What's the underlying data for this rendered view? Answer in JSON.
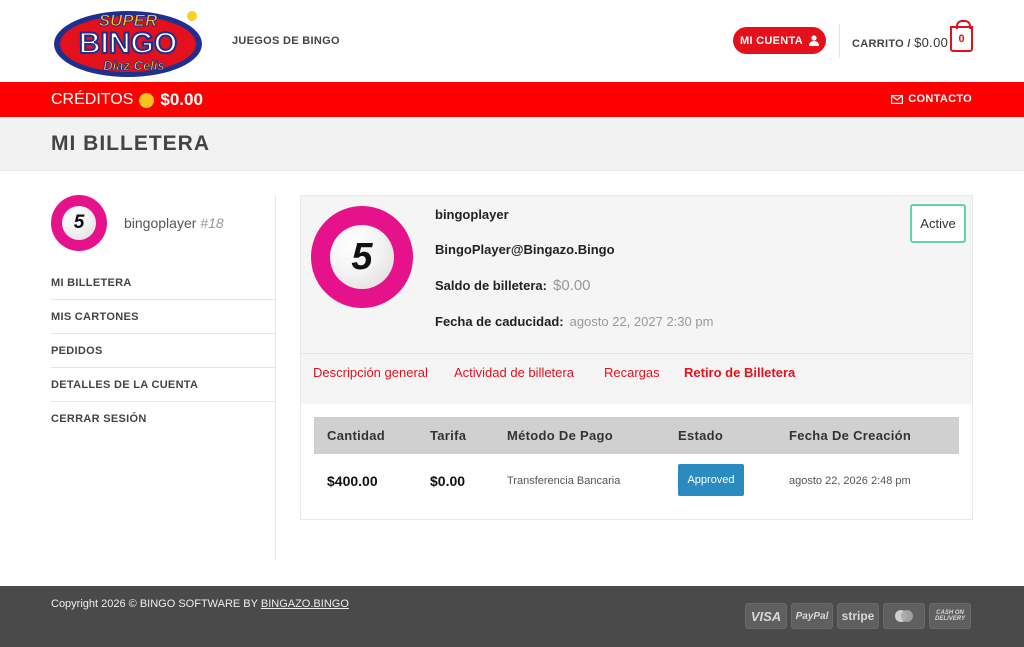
{
  "header": {
    "logo": {
      "line1": "SUPER",
      "line2": "BINGO",
      "line3": "Diaz Celis"
    },
    "nav_games": "JUEGOS DE BINGO",
    "account_label": "MI CUENTA",
    "cart_label": "CARRITO /",
    "cart_amount": "$0.00",
    "cart_count": "0"
  },
  "bar": {
    "credits_label": "CRÉDITOS",
    "credits_value": "$0.00",
    "contact_label": "CONTACTO"
  },
  "page": {
    "title": "MI BILLETERA"
  },
  "user": {
    "ball_number": "5",
    "username": "bingoplayer",
    "user_id": "#18"
  },
  "sidebar": {
    "items": [
      {
        "label": "MI BILLETERA"
      },
      {
        "label": "MIS CARTONES"
      },
      {
        "label": "PEDIDOS"
      },
      {
        "label": "DETALLES DE LA CUENTA"
      },
      {
        "label": "CERRAR SESIÓN"
      }
    ]
  },
  "wallet": {
    "username": "bingoplayer",
    "email": "BingoPlayer@Bingazo.Bingo",
    "balance_label": "Saldo de billetera:",
    "balance_value": "$0.00",
    "expiry_label": "Fecha de caducidad:",
    "expiry_value": "agosto 22, 2027 2:30 pm",
    "status": "Active"
  },
  "tabs": [
    {
      "label": "Descripción general"
    },
    {
      "label": "Actividad de billetera"
    },
    {
      "label": "Recargas"
    },
    {
      "label": "Retiro de Billetera"
    }
  ],
  "table": {
    "headers": [
      "Cantidad",
      "Tarifa",
      "Método De Pago",
      "Estado",
      "Fecha De Creación"
    ],
    "rows": [
      {
        "amount": "$400.00",
        "fee": "$0.00",
        "method": "Transferencia Bancaria",
        "status": "Approved",
        "date": "agosto 22, 2026 2:48 pm"
      }
    ]
  },
  "footer": {
    "copyright": "Copyright 2026 © BINGO SOFTWARE BY",
    "link": "BINGAZO.BINGO",
    "payments": [
      "VISA",
      "PayPal",
      "stripe",
      "mastercard",
      "CASH ON DELIVERY"
    ]
  },
  "colors": {
    "accent": "#e4111c",
    "bar": "#ff0000",
    "ball": "#e6128c",
    "approved": "#2a8bc0",
    "active_border": "#5fd3b2"
  }
}
